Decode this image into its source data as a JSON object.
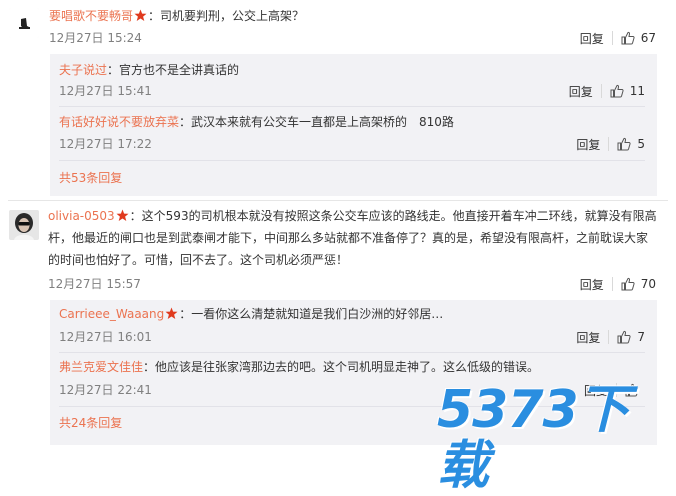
{
  "comments": [
    {
      "user": "要唱歌不要畅哥",
      "text": "：司机要判刑，公交上高架？",
      "time": "12月27日 15:24",
      "reply": "回复",
      "likes": "67",
      "replies": [
        {
          "user": "夫子说过",
          "text": "：官方也不是全讲真话的",
          "time": "12月27日 15:41",
          "reply": "回复",
          "likes": "11"
        },
        {
          "user": "有话好好说不要放弃菜",
          "text": "：武汉本来就有公交车一直都是上高架桥的　810路",
          "time": "12月27日 17:22",
          "reply": "回复",
          "likes": "5"
        }
      ],
      "more": "共53条回复"
    },
    {
      "user": "olivia-0503",
      "text_lines": [
        "：这个593的司机根本就没有按照这条公交车应该的路线走。他直接开着车冲二环线，就算没有限高",
        "杆，他最近的闸口也是到武泰闸才能下，中间那么多站就都不准备停了？真的是，希望没有限高杆，之前耽误大家",
        "的时间也怕好了。可惜，回不去了。这个司机必须严惩！"
      ],
      "time": "12月27日 15:57",
      "reply": "回复",
      "likes": "70",
      "replies": [
        {
          "user": "Carrieee_Waaang",
          "text": "：一看你这么清楚就知道是我们白沙洲的好邻居…",
          "time": "12月27日 16:01",
          "reply": "回复",
          "likes": "7"
        },
        {
          "user": "弗兰克爱文佳佳",
          "text": "：他应该是往张家湾那边去的吧。这个司机明显走神了。这么低级的错误。",
          "time": "12月27日 22:41",
          "reply": "回复",
          "likes": ""
        }
      ],
      "more": "共24条回复"
    }
  ],
  "watermark": "5373下载",
  "colors": {
    "name": "#eb7350",
    "time": "#808080",
    "sub_bg": "#f2f2f5",
    "watermark": "#2a8ee0",
    "vip": "#e03a1e"
  }
}
